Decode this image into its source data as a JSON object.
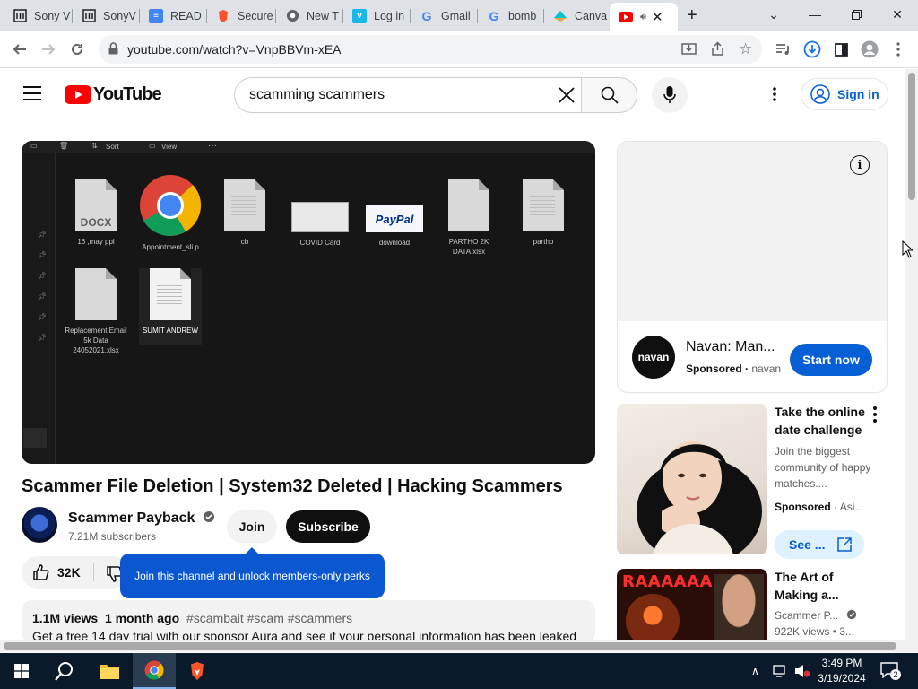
{
  "browser": {
    "tabs": [
      {
        "title": "Sony V",
        "icon": "archive-icon"
      },
      {
        "title": "SonyV",
        "icon": "archive-icon"
      },
      {
        "title": "READ",
        "icon": "docs-icon"
      },
      {
        "title": "Secure",
        "icon": "brave-icon"
      },
      {
        "title": "New T",
        "icon": "chrome-icon"
      },
      {
        "title": "Log in",
        "icon": "vimeo-icon"
      },
      {
        "title": "Gmail",
        "icon": "google-icon"
      },
      {
        "title": "bomb",
        "icon": "google-icon"
      },
      {
        "title": "Canva",
        "icon": "canva-icon"
      },
      {
        "title": "",
        "icon": "youtube-icon",
        "active": true
      }
    ],
    "url": "youtube.com/watch?v=VnpBBVm-xEA"
  },
  "youtube": {
    "logo_text": "YouTube",
    "search_value": "scamming scammers",
    "signin_label": "Sign in"
  },
  "player": {
    "toolbar": {
      "sort": "Sort",
      "view": "View",
      "more": "···"
    },
    "files": [
      {
        "name": "16 ,may ppl",
        "badge": "DOCX"
      },
      {
        "name": "Appointment_sli p",
        "badge": ""
      },
      {
        "name": "cb",
        "badge": ""
      },
      {
        "name": "COVID Card",
        "badge": ""
      },
      {
        "name": "download",
        "badge": "PayPal"
      },
      {
        "name": "PARTHO 2K DATA.xlsx",
        "badge": ""
      },
      {
        "name": "partho",
        "badge": ""
      },
      {
        "name": "Replacement Email 5k Data 24052021.xlsx",
        "badge": ""
      },
      {
        "name": "SUMIT ANDREW",
        "badge": ""
      }
    ]
  },
  "video": {
    "title": "Scammer File Deletion | System32 Deleted | Hacking Scammers",
    "channel": "Scammer Payback",
    "subscribers": "7.21M subscribers",
    "join_label": "Join",
    "subscribe_label": "Subscribe",
    "likes": "32K",
    "tooltip": "Join this channel and unlock members-only perks",
    "views": "1.1M views",
    "age": "1 month ago",
    "tags": "#scambait #scam #scammers",
    "description": "Get a free 14 day trial with our sponsor Aura and see if your personal information has been leaked"
  },
  "ad": {
    "logo_text": "navan",
    "title": "Navan: Man...",
    "sponsored": "Sponsored",
    "advertiser": "navan",
    "cta": "Start now"
  },
  "sidebar": [
    {
      "title": "Take the online date challenge",
      "desc": "Join the biggest community of happy matches....",
      "sponsored": "Sponsored",
      "advertiser": "Asi...",
      "cta": "See ..."
    },
    {
      "title": "The Art of Making a...",
      "channel": "Scammer P...",
      "views": "922K views",
      "age": "3..."
    }
  ],
  "taskbar": {
    "time": "3:49 PM",
    "date": "3/19/2024",
    "notifications": "2"
  }
}
